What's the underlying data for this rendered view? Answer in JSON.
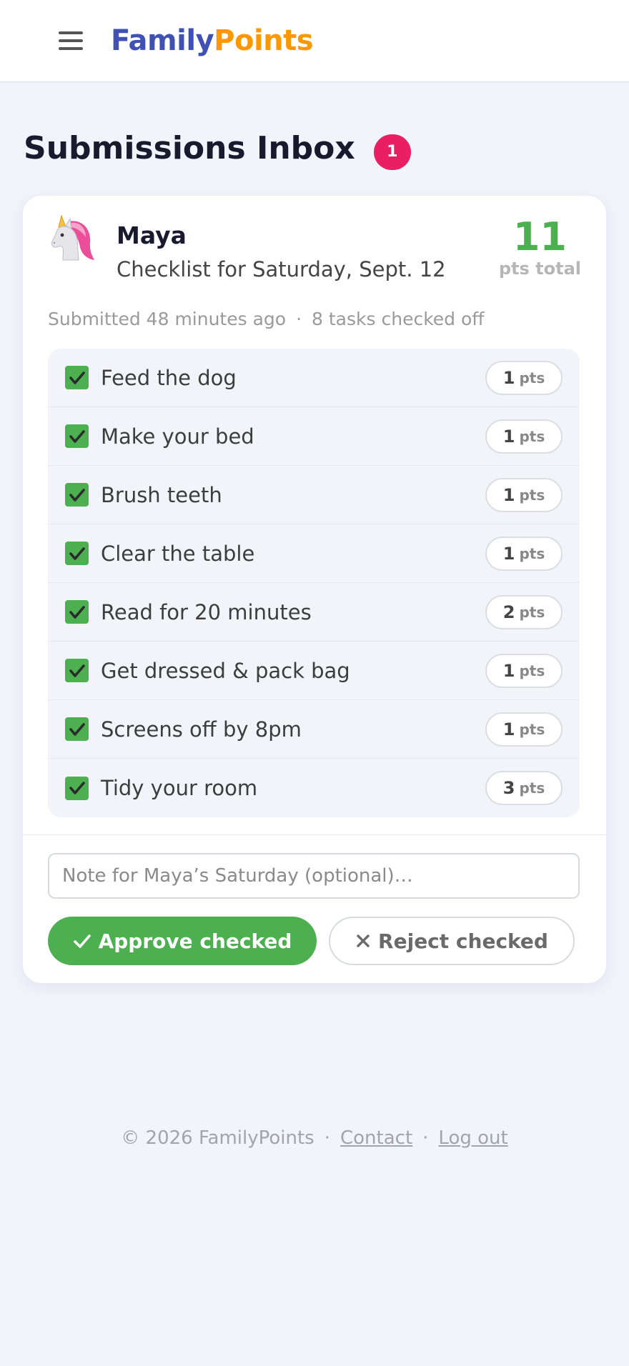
{
  "app": {
    "brand_part1": "Family",
    "brand_part2": "Points"
  },
  "page": {
    "title": "Submissions Inbox",
    "badge_count": "1"
  },
  "submission": {
    "kid_name": "Maya",
    "avatar_icon": "unicorn-icon",
    "checklist_title": "Checklist for Saturday, Sept. 12",
    "points_total": "11",
    "points_total_label": "pts total",
    "submitted_text": "Submitted 48 minutes ago",
    "separator": "·",
    "tasks_checked_text": "8 tasks checked off",
    "tasks": [
      {
        "label": "Feed the dog",
        "points": "1",
        "unit": "pts",
        "checked": true
      },
      {
        "label": "Make your bed",
        "points": "1",
        "unit": "pts",
        "checked": true
      },
      {
        "label": "Brush teeth",
        "points": "1",
        "unit": "pts",
        "checked": true
      },
      {
        "label": "Clear the table",
        "points": "1",
        "unit": "pts",
        "checked": true
      },
      {
        "label": "Read for 20 minutes",
        "points": "2",
        "unit": "pts",
        "checked": true
      },
      {
        "label": "Get dressed & pack bag",
        "points": "1",
        "unit": "pts",
        "checked": true
      },
      {
        "label": "Screens off by 8pm",
        "points": "1",
        "unit": "pts",
        "checked": true
      },
      {
        "label": "Tidy your room",
        "points": "3",
        "unit": "pts",
        "checked": true
      }
    ],
    "note_placeholder": "Note for Maya’s Saturday (optional)…",
    "note_value": "",
    "approve_label": "Approve checked",
    "reject_label": "Reject checked"
  },
  "footer": {
    "copyright": "© 2026 FamilyPoints",
    "separator": "·",
    "contact_label": "Contact",
    "logout_label": "Log out"
  },
  "colors": {
    "brand_primary": "#3f51b5",
    "brand_accent": "#ff9800",
    "badge": "#e91e63",
    "success": "#4caf50"
  }
}
